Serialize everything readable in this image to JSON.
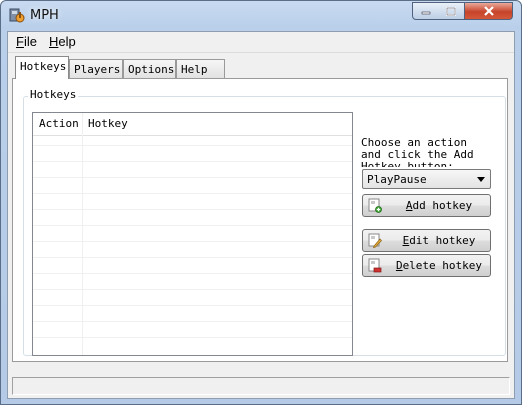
{
  "window": {
    "title": "MPH"
  },
  "menu": [
    {
      "label": "File",
      "accel": "F",
      "rest": "ile"
    },
    {
      "label": "Help",
      "accel": "H",
      "rest": "elp"
    }
  ],
  "tabs": [
    {
      "label": "Hotkeys",
      "active": true
    },
    {
      "label": "Players",
      "active": false
    },
    {
      "label": "Options",
      "active": false
    },
    {
      "label": "Help",
      "active": false
    }
  ],
  "hotkeys": {
    "group_title": "Hotkeys",
    "columns": [
      "Action",
      "Hotkey"
    ],
    "rows": [],
    "hint": "Choose an action and click the Add Hotkey button:",
    "action_select": {
      "value": "PlayPause"
    },
    "buttons": {
      "add": {
        "label": "Add hotkey",
        "accel": "A",
        "rest": "dd hotkey"
      },
      "edit": {
        "label": "Edit hotkey",
        "accel": "E",
        "rest": "dit hotkey"
      },
      "delete": {
        "label": "Delete hotkey",
        "accel": "D",
        "rest": "elete hotkey"
      }
    }
  },
  "status": {
    "text": ""
  },
  "icons": {
    "app": "mph-app-icon",
    "minimize": "minimize-icon",
    "maximize": "maximize-icon",
    "close": "close-icon",
    "add": "add-hotkey-icon",
    "edit": "edit-hotkey-icon",
    "delete": "delete-hotkey-icon"
  }
}
